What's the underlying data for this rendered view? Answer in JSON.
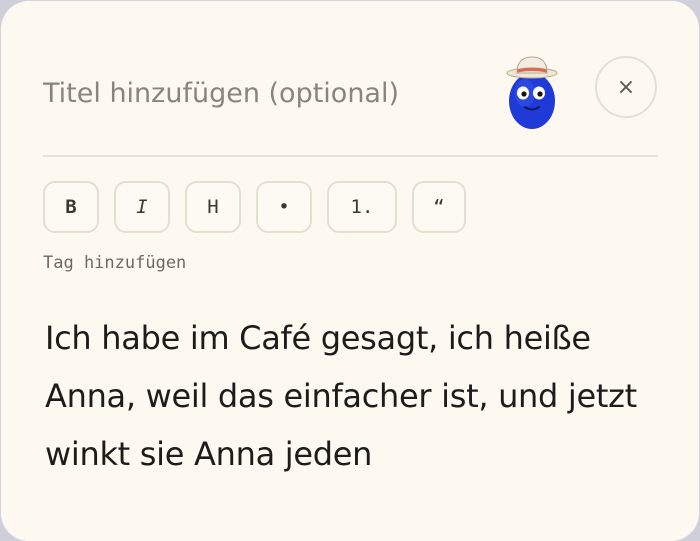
{
  "editor": {
    "title_placeholder": "Titel hinzufügen (optional)",
    "close_label": "×",
    "tag_link": "Tag hinzufügen",
    "body_text": "Ich habe im Café gesagt, ich heiße Anna, weil das einfacher ist, und jetzt winkt sie Anna jeden"
  },
  "toolbar": {
    "buttons": [
      {
        "label": "B",
        "icon": "bold-icon"
      },
      {
        "label": "I",
        "icon": "italic-icon"
      },
      {
        "label": "H",
        "icon": "heading-icon"
      },
      {
        "label": "•",
        "icon": "bullet-list-icon"
      },
      {
        "label": "1.",
        "icon": "numbered-list-icon"
      },
      {
        "label": "“",
        "icon": "quote-icon"
      }
    ]
  },
  "colors": {
    "card_background": "#fdf9f1",
    "mascot_body": "#1f3ad6",
    "hat": "#f3ece0",
    "hat_band": "#d96b50"
  }
}
